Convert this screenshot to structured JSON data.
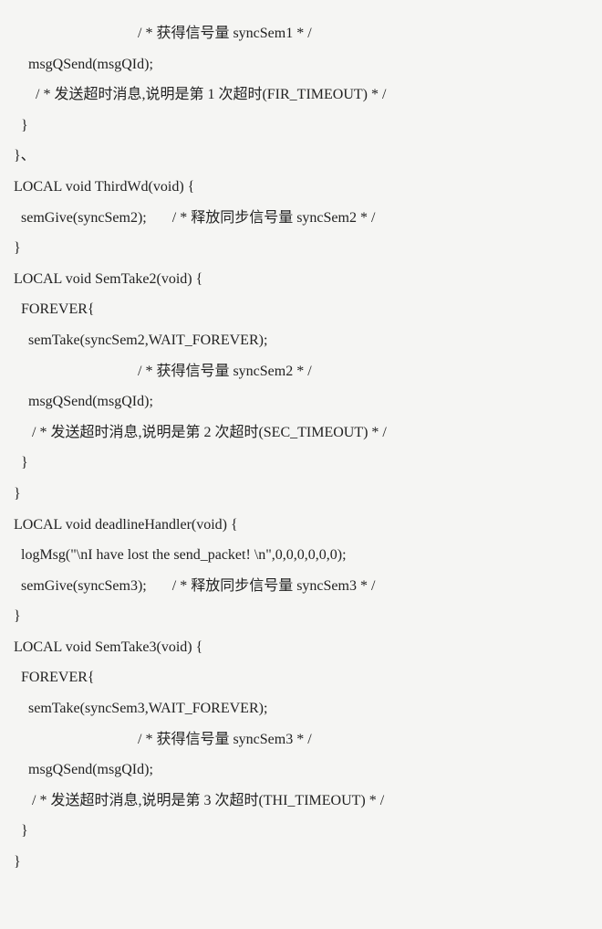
{
  "lines": [
    "                                  / * 获得信号量 syncSem1 * /",
    "    msgQSend(msgQId);",
    "      / * 发送超时消息,说明是第 1 次超时(FIR_TIMEOUT) * /",
    "  }",
    "}、",
    "LOCAL void ThirdWd(void) {",
    "  semGive(syncSem2);       / * 释放同步信号量 syncSem2 * /",
    "}",
    "LOCAL void SemTake2(void) {",
    "  FOREVER{",
    "    semTake(syncSem2,WAIT_FOREVER);",
    "                                  / * 获得信号量 syncSem2 * /",
    "    msgQSend(msgQId);",
    "     / * 发送超时消息,说明是第 2 次超时(SEC_TIMEOUT) * /",
    "  }",
    "}",
    "LOCAL void deadlineHandler(void) {",
    "  logMsg(\"\\nI have lost the send_packet! \\n\",0,0,0,0,0,0);",
    "  semGive(syncSem3);       / * 释放同步信号量 syncSem3 * /",
    "}",
    "LOCAL void SemTake3(void) {",
    "  FOREVER{",
    "    semTake(syncSem3,WAIT_FOREVER);",
    "                                  / * 获得信号量 syncSem3 * /",
    "    msgQSend(msgQId);",
    "     / * 发送超时消息,说明是第 3 次超时(THI_TIMEOUT) * /",
    "  }",
    "}"
  ]
}
